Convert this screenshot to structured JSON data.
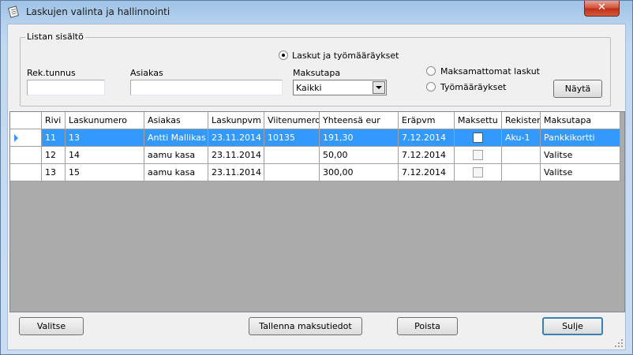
{
  "window": {
    "title": "Laskujen valinta ja hallinnointi",
    "close_label": "✕"
  },
  "filters": {
    "group_label": "Listan sisältö",
    "rek_label": "Rek.tunnus",
    "rek_value": "",
    "asiakas_label": "Asiakas",
    "asiakas_value": "",
    "maksutapa_label": "Maksutapa",
    "maksutapa_value": "Kaikki",
    "radio_all": "Laskut ja työmääräykset",
    "radio_unpaid": "Maksamattomat laskut",
    "radio_work": "Työmääräykset",
    "show_button": "Näytä"
  },
  "table": {
    "columns": [
      "Rivi",
      "Laskunumero",
      "Asiakas",
      "Laskunpvm",
      "Viitenumero",
      "Yhteensä eur",
      "Eräpvm",
      "Maksettu",
      "Rekisteri",
      "Maksutapa"
    ],
    "rows": [
      {
        "rivi": "11",
        "laskunumero": "13",
        "asiakas": "Antti Mallikas",
        "laskunpvm": "23.11.2014",
        "viitenumero": "10135",
        "yhteensa": "191,30",
        "erapvm": "7.12.2014",
        "maksettu": false,
        "rekisteri": "Aku-1",
        "maksutapa": "Pankkikortti"
      },
      {
        "rivi": "12",
        "laskunumero": "14",
        "asiakas": "aamu kasa",
        "laskunpvm": "23.11.2014",
        "viitenumero": "",
        "yhteensa": "50,00",
        "erapvm": "7.12.2014",
        "maksettu": false,
        "rekisteri": "",
        "maksutapa": "Valitse"
      },
      {
        "rivi": "13",
        "laskunumero": "15",
        "asiakas": "aamu kasa",
        "laskunpvm": "23.11.2014",
        "viitenumero": "",
        "yhteensa": "300,00",
        "erapvm": "7.12.2014",
        "maksettu": false,
        "rekisteri": "",
        "maksutapa": "Valitse"
      }
    ]
  },
  "buttons": {
    "valitse": "Valitse",
    "tallenna": "Tallenna maksutiedot",
    "poista": "Poista",
    "sulje": "Sulje"
  },
  "icons": {
    "app": "notepad-icon",
    "close": "close-icon"
  }
}
